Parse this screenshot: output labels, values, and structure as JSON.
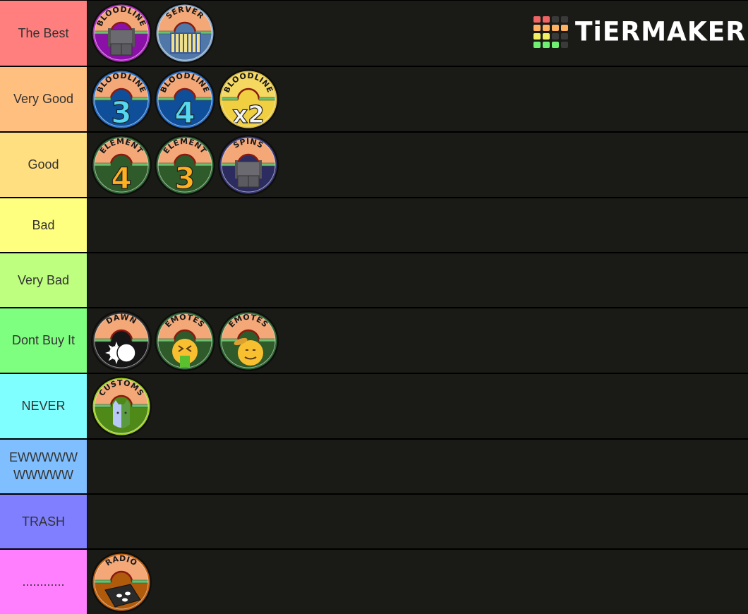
{
  "logo": {
    "text": "TiERMAKER",
    "grid": [
      "#f06464",
      "#f06464",
      "#3a3a3a",
      "#3a3a3a",
      "#ffb060",
      "#ffb060",
      "#ffb060",
      "#ffb060",
      "#f0f060",
      "#f0f060",
      "#3a3a3a",
      "#3a3a3a",
      "#70f070",
      "#70f070",
      "#70f070",
      "#3a3a3a"
    ]
  },
  "tiers": [
    {
      "label": "The Best",
      "color": "#ff7f7f",
      "items": [
        {
          "title": "BLOODLINE",
          "icon": "spin-machine-icon",
          "rim": "#b030c0",
          "bottom": "#8a10a8"
        },
        {
          "title": "SERVER",
          "icon": "server-scroll-icon",
          "rim": "#8aa8c8",
          "bottom": "#4f78a8"
        }
      ]
    },
    {
      "label": "Very Good",
      "color": "#ffbf7f",
      "items": [
        {
          "title": "BLOODLINE",
          "icon": "number-3-icon",
          "glyph": "3",
          "rim": "#2a70c8",
          "bottom": "#0f4f9a",
          "glyphColor": "#55d8f0"
        },
        {
          "title": "BLOODLINE",
          "icon": "number-4-icon",
          "glyph": "4",
          "rim": "#2a70c8",
          "bottom": "#0f4f9a",
          "glyphColor": "#55d8f0"
        },
        {
          "title": "BLOODLINE",
          "icon": "x2-multiplier-icon",
          "glyph": "x2",
          "rim": "#e0c040",
          "bottom": "#f0d040",
          "glyphColor": "#f4f4f4",
          "top": "#f4d860"
        }
      ]
    },
    {
      "label": "Good",
      "color": "#ffdf7f",
      "items": [
        {
          "title": "ELEMENT",
          "icon": "number-4-icon",
          "glyph": "4",
          "rim": "#2f6a35",
          "bottom": "#2f5a2a",
          "glyphColor": "#ffb020"
        },
        {
          "title": "ELEMENT",
          "icon": "number-3-icon",
          "glyph": "3",
          "rim": "#2f6a35",
          "bottom": "#2f5a2a",
          "glyphColor": "#ffb020"
        },
        {
          "title": "SPINS",
          "icon": "spin-machine-icon",
          "rim": "#3a3a78",
          "bottom": "#2c2c60"
        }
      ]
    },
    {
      "label": "Bad",
      "color": "#ffff7f",
      "items": []
    },
    {
      "label": "Very Bad",
      "color": "#bfff7f",
      "items": []
    },
    {
      "label": "Dont Buy It",
      "color": "#7fff7f",
      "items": [
        {
          "title": "DAWN",
          "icon": "sun-moon-icon",
          "rim": "#303030",
          "bottom": "#161616"
        },
        {
          "title": "EMOTES",
          "icon": "vomit-emoji-icon",
          "rim": "#2f6a35",
          "bottom": "#2f5a2a"
        },
        {
          "title": "EMOTES",
          "icon": "salute-emoji-icon",
          "rim": "#2f6a35",
          "bottom": "#2f5a2a"
        }
      ]
    },
    {
      "label": "NEVER",
      "color": "#7fffff",
      "items": [
        {
          "title": "CUSTOMS",
          "icon": "cat-mask-icon",
          "rim": "#a0d020",
          "bottom": "#4f8a18"
        }
      ]
    },
    {
      "label": "EWWWWWWWWWW",
      "color": "#7fbfff",
      "items": []
    },
    {
      "label": "TRASH",
      "color": "#7f7fff",
      "items": []
    },
    {
      "label": "............",
      "color": "#ff7fff",
      "items": [
        {
          "title": "RADIO",
          "icon": "boombox-icon",
          "rim": "#c06010",
          "bottom": "#b05a0c"
        }
      ]
    }
  ]
}
